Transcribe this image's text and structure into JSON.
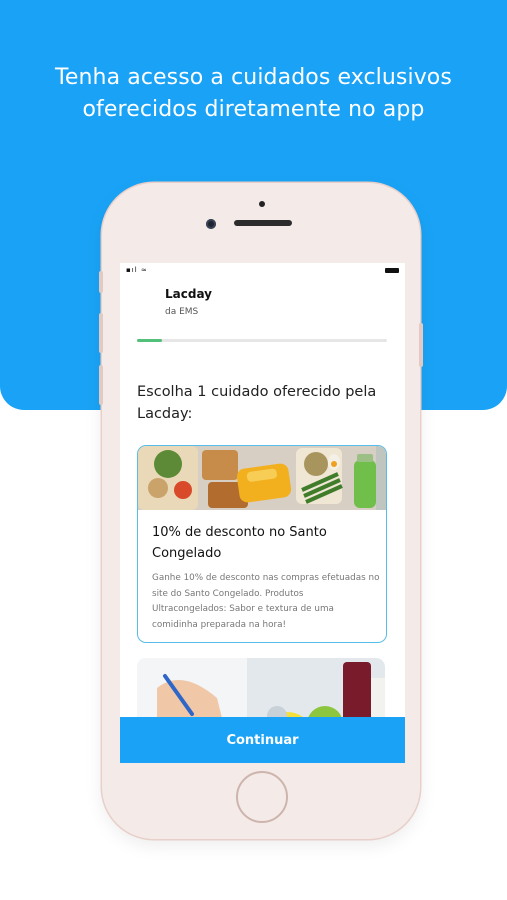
{
  "hero": {
    "line1": "Tenha acesso a cuidados exclusivos",
    "line2": "oferecidos diretamente no app"
  },
  "colors": {
    "brand_blue": "#1aa3f6",
    "progress": "#53c07a",
    "card_border": "#57bce8"
  },
  "app": {
    "status_left": "▪ıl ≈",
    "brand_title": "Lacday",
    "brand_subtitle": "da EMS",
    "progress_fraction": 0.1,
    "prompt": "Escolha 1 cuidado oferecido pela Lacday:",
    "offers": [
      {
        "title": "10% de desconto no Santo Congelado",
        "description": "Ganhe 10% de desconto nas compras efetuadas no site do Santo Congelado. Produtos Ultracongelados: Sabor e textura de uma comidinha preparada na hora!",
        "image": "frozen-meals-photo"
      },
      {
        "image": "healthcare-photo"
      }
    ],
    "continue_label": "Continuar"
  }
}
